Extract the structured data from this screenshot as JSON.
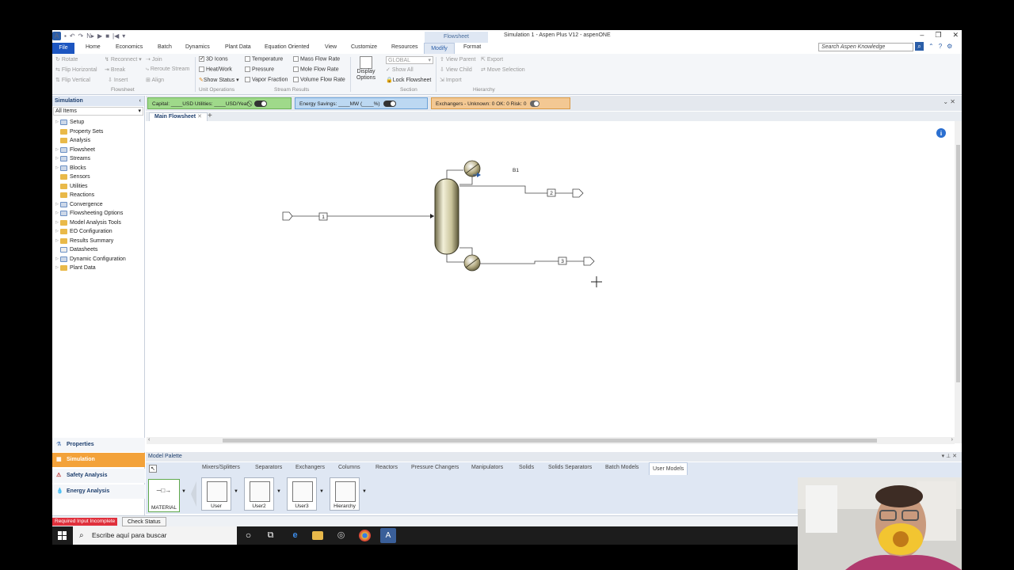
{
  "window": {
    "title": "Simulation 1 - Aspen Plus V12 - aspenONE",
    "context_tab": "Flowsheet"
  },
  "menu": [
    "File",
    "Home",
    "Economics",
    "Batch",
    "Dynamics",
    "Plant Data",
    "Equation Oriented",
    "View",
    "Customize",
    "Resources",
    "Modify",
    "Format"
  ],
  "search": {
    "placeholder": "Search Aspen Knowledge"
  },
  "ribbon": {
    "flowsheet": {
      "rotate": "Rotate",
      "flip_h": "Flip Horizontal",
      "flip_v": "Flip Vertical",
      "reconnect": "Reconnect",
      "break": "Break",
      "insert": "Insert",
      "join": "Join",
      "reroute": "Reroute Stream",
      "align": "Align",
      "group": "Flowsheet"
    },
    "unit_ops": {
      "icons3d": "3D Icons",
      "heat_work": "Heat/Work",
      "show_status": "Show Status",
      "group": "Unit Operations"
    },
    "stream_results": {
      "temperature": "Temperature",
      "pressure": "Pressure",
      "vapor_fraction": "Vapor Fraction",
      "mass_flow": "Mass Flow Rate",
      "mole_flow": "Mole Flow Rate",
      "volume_flow": "Volume Flow Rate",
      "group": "Stream Results"
    },
    "display": {
      "options": "Display Options",
      "global": "GLOBAL",
      "show_all": "Show All",
      "lock": "Lock Flowsheet",
      "group": "Section"
    },
    "hierarchy": {
      "view_parent": "View Parent",
      "view_child": "View Child",
      "import": "Import",
      "export": "Export",
      "move_selection": "Move Selection",
      "group": "Hierarchy"
    }
  },
  "left_panel": {
    "header": "Simulation",
    "filter": "All Items",
    "tree": [
      "Setup",
      "Property Sets",
      "Analysis",
      "Flowsheet",
      "Streams",
      "Blocks",
      "Sensors",
      "Utilities",
      "Reactions",
      "Convergence",
      "Flowsheeting Options",
      "Model Analysis Tools",
      "EO Configuration",
      "Results Summary",
      "Datasheets",
      "Dynamic Configuration",
      "Plant Data"
    ],
    "nav": [
      "Properties",
      "Simulation",
      "Safety Analysis",
      "Energy Analysis"
    ]
  },
  "infobar": {
    "capital": "Capital: ____USD  Utilities: ____USD/Year",
    "energy": "Energy Savings: ____MW   (____%)",
    "exchangers": "Exchangers -   Unknown: 0   OK: 0   Risk: 0"
  },
  "doc_tab": "Main Flowsheet",
  "flowsheet": {
    "block_label": "B1",
    "streams": [
      "1",
      "2",
      "3"
    ]
  },
  "palette": {
    "header": "Model Palette",
    "tabs": [
      "Mixers/Splitters",
      "Separators",
      "Exchangers",
      "Columns",
      "Reactors",
      "Pressure Changers",
      "Manipulators",
      "Solids",
      "Solids Separators",
      "Batch Models",
      "User Models"
    ],
    "items": [
      "MATERIAL",
      "User",
      "User2",
      "User3",
      "Hierarchy"
    ]
  },
  "status": {
    "error": "Required Input Incomplete",
    "check": "Check Status"
  },
  "taskbar": {
    "search": "Escribe aquí para buscar"
  }
}
